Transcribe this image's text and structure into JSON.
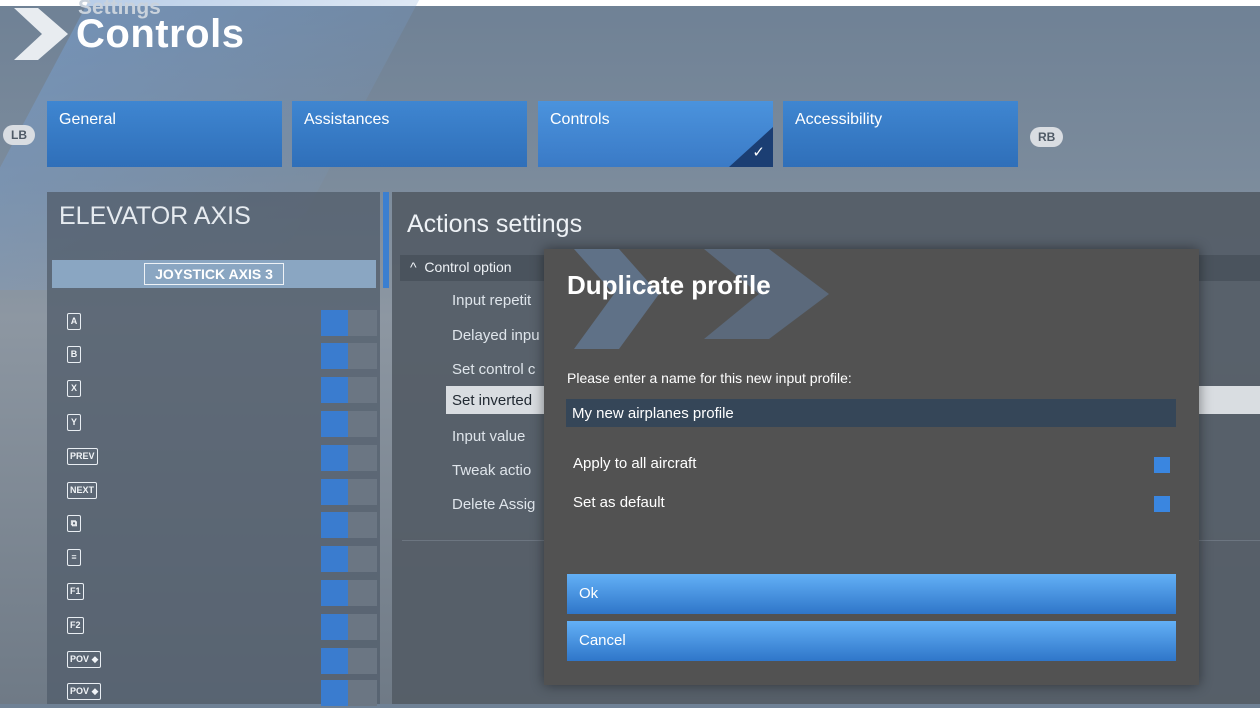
{
  "header": {
    "subtitle": "Settings",
    "title": "Controls"
  },
  "bumpers": {
    "left": "LB",
    "right": "RB"
  },
  "tabs": [
    {
      "label": "General",
      "active": false
    },
    {
      "label": "Assistances",
      "active": false
    },
    {
      "label": "Controls",
      "active": true
    },
    {
      "label": "Accessibility",
      "active": false
    }
  ],
  "left_panel": {
    "title": "ELEVATOR AXIS",
    "axis_label": "JOYSTICK AXIS 3",
    "keys": [
      {
        "label": "A"
      },
      {
        "label": "B"
      },
      {
        "label": "X"
      },
      {
        "label": "Y"
      },
      {
        "label": "PREV"
      },
      {
        "label": "NEXT"
      },
      {
        "label": "⧉"
      },
      {
        "label": "≡"
      },
      {
        "label": "F1"
      },
      {
        "label": "F2"
      },
      {
        "label": "POV ◆"
      },
      {
        "label": "POV ◆"
      }
    ]
  },
  "right_panel": {
    "title": "Actions settings",
    "section_label": "Control option",
    "rows": [
      "Input repetit",
      "Delayed inpu",
      "Set control c",
      "Set inverted",
      "Input value",
      "Tweak actio",
      "Delete Assig"
    ],
    "highlighted_row_index": 3
  },
  "dialog": {
    "title": "Duplicate profile",
    "prompt": "Please enter a name for this new input profile:",
    "input_value": "My new airplanes profile",
    "options": [
      {
        "label": "Apply to all aircraft",
        "checked": true
      },
      {
        "label": "Set as default",
        "checked": true
      }
    ],
    "ok_label": "Ok",
    "cancel_label": "Cancel"
  },
  "colors": {
    "accent_blue": "#3a86e0",
    "tab_blue": "#3f86d1",
    "dialog_bg": "#525252"
  }
}
